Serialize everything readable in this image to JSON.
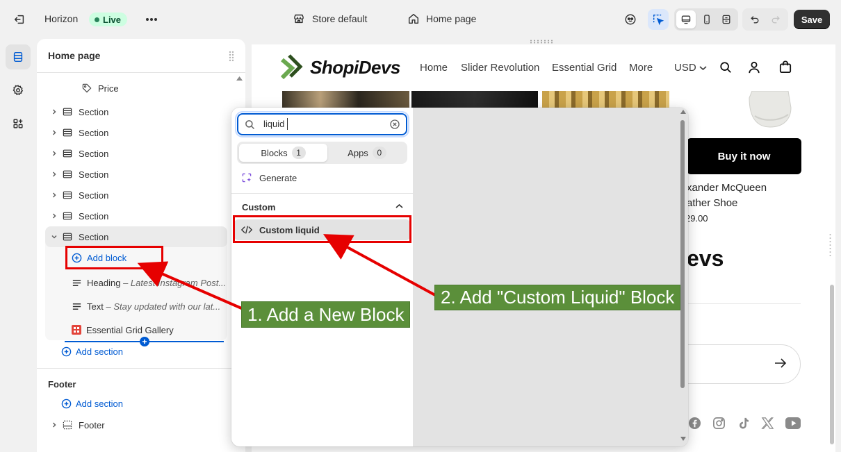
{
  "topbar": {
    "theme_name": "Horizon",
    "live_label": "Live",
    "store_label": "Store default",
    "page_label": "Home page",
    "save_label": "Save"
  },
  "sidebar": {
    "title": "Home page",
    "price_label": "Price",
    "sections": [
      "Section",
      "Section",
      "Section",
      "Section",
      "Section",
      "Section"
    ],
    "expanded_section": "Section",
    "add_block_label": "Add block",
    "blocks": [
      {
        "type": "Heading",
        "detail": "Latest Instagram Post..."
      },
      {
        "type": "Text",
        "detail": "Stay updated with our lat..."
      },
      {
        "type": "Essential Grid Gallery",
        "detail": ""
      }
    ],
    "add_section_label": "Add section",
    "footer_group_title": "Footer",
    "footer_add_section_label": "Add section",
    "footer_section_label": "Footer"
  },
  "popup": {
    "search_value": "liquid",
    "tab_blocks_label": "Blocks",
    "tab_blocks_count": "1",
    "tab_apps_label": "Apps",
    "tab_apps_count": "0",
    "generate_label": "Generate",
    "category_label": "Custom",
    "result_label": "Custom liquid"
  },
  "preview": {
    "logo_text": "ShopiDevs",
    "nav": [
      "Home",
      "Slider Revolution",
      "Essential Grid",
      "More"
    ],
    "currency": "USD",
    "buy_now_label": "Buy it now",
    "product_name_line1": "xander McQueen",
    "product_name_line2": "ather Shoe",
    "product_price": "29.00",
    "brand_partial": "evs"
  },
  "annotations": {
    "step1": "1. Add a New Block",
    "step2": "2. Add \"Custom Liquid\" Block"
  },
  "colors": {
    "accent_blue": "#005bd3",
    "live_green": "#29845a",
    "annotation_red": "#e60000",
    "callout_green": "#5b8f3a"
  }
}
